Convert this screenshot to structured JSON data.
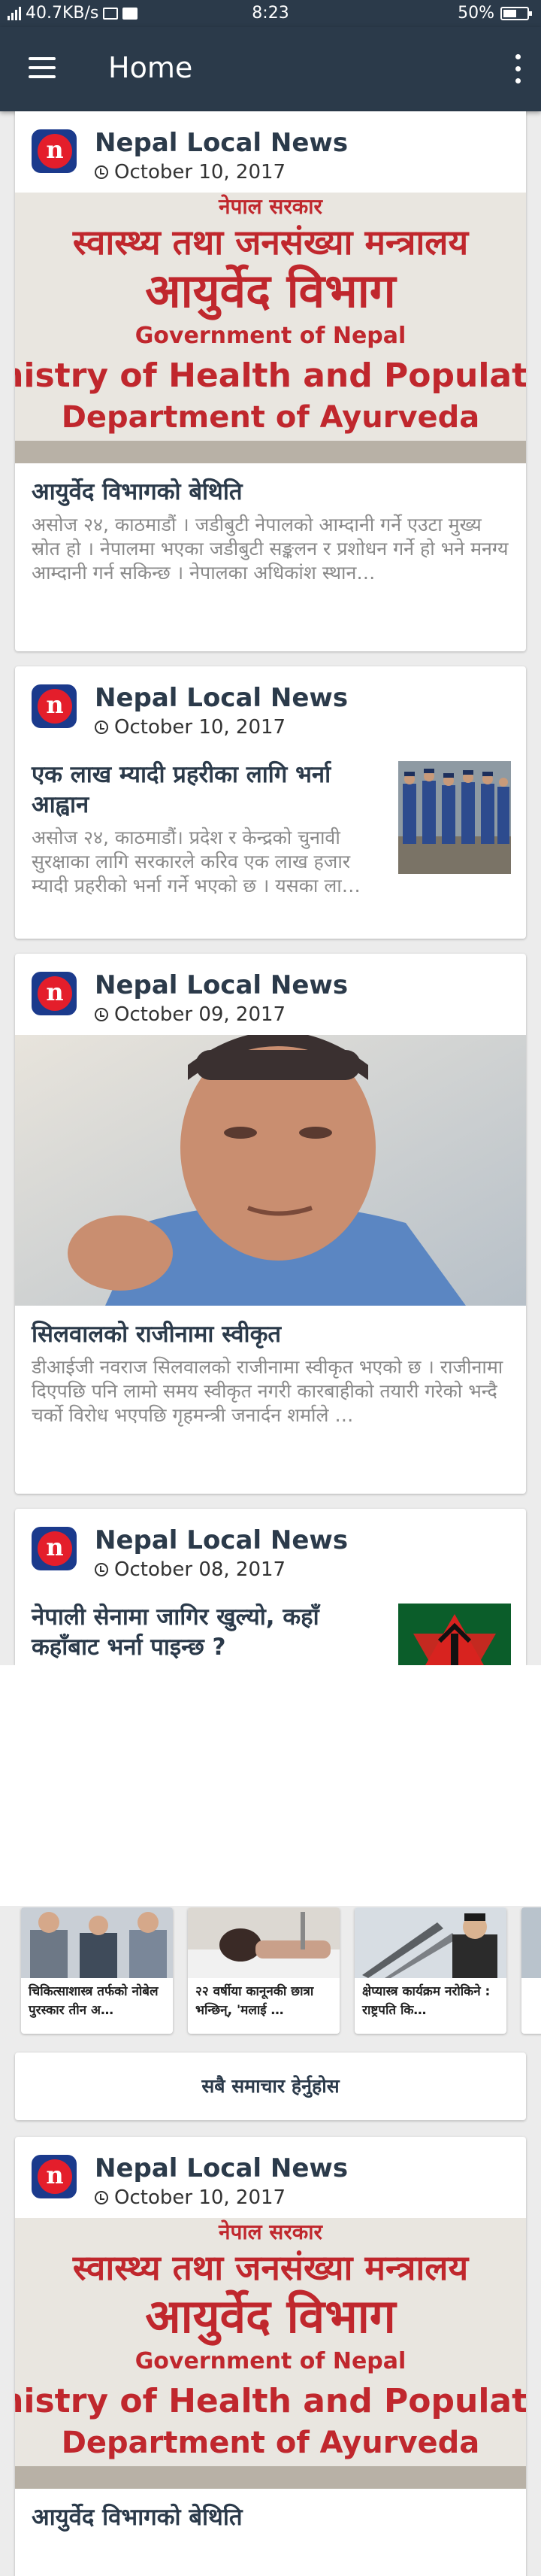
{
  "status_bar": {
    "speed": "40.7KB/s",
    "time": "8:23",
    "battery": "50%",
    "battery_level": 0.5
  },
  "app_bar": {
    "title": "Home",
    "menu_icon": "hamburger-menu-icon",
    "more_icon": "more-vertical-icon"
  },
  "articles": [
    {
      "source": "Nepal Local News",
      "date": "October 10, 2017",
      "headline": "आयुर्वेद विभागको बेथिति",
      "excerpt": "असोज २४, काठमाडौं ।  जडीबुटी नेपालको आम्दानी गर्ने एउटा मुख्य स्रोत हो । नेपालमा भएका जडीबुटी सङ्कलन र प्रशोधन गर्ने हो भने मनग्य आम्दानी गर्न सकिन्छ । नेपालका अधिकांश स्थान…",
      "image": "ministry-sign",
      "sign_lines": [
        "नेपाल सरकार",
        "स्वास्थ्य तथा जनसंख्या मन्त्रालय",
        "आयुर्वेद विभाग",
        "Government of Nepal",
        "Ministry of Health and Population",
        "Department of Ayurveda"
      ]
    },
    {
      "source": "Nepal Local News",
      "date": "October 10, 2017",
      "headline": "एक लाख म्यादी प्रहरीका लागि भर्ना आह्वान",
      "excerpt": "असोज २४, काठमाडौं।  प्रदेश र केन्द्रको चुनावी सुरक्षाका लागि सरकारले करिव एक लाख हजार म्यादी प्रहरीको भर्ना गर्ने भएको छ । यसका ला…",
      "image": "police-parade"
    },
    {
      "source": "Nepal Local News",
      "date": "October 09, 2017",
      "headline": "सिलवालको राजीनामा स्वीकृत",
      "excerpt": "डीआईजी नवराज सिलवालको राजीनामा स्वीकृत भएको छ । राजीनामा दिएपछि पनि लामो समय स्वीकृत नगरी कारबाहीको तयारी गरेको भन्दै चर्को विरोध भएपछि गृहमन्त्री जनार्दन शर्माले …",
      "image": "man-portrait"
    },
    {
      "source": "Nepal Local News",
      "date": "October 08, 2017",
      "headline": "नेपाली सेनामा जागिर खुल्यो, कहाँ कहाँबाट भर्ना पाइन्छ ?",
      "excerpt": "",
      "image": "army-emblem"
    },
    {
      "source": "Nepal Local News",
      "date": "October 10, 2017",
      "headline": "आयुर्वेद विभागको बेथिति",
      "excerpt": "",
      "image": "ministry-sign"
    }
  ],
  "carousel": [
    {
      "caption": "चिकित्साशास्त्र तर्फको नोबेल पुरस्कार तीन अ…",
      "image": "nobel-photo"
    },
    {
      "caption": "२२ वर्षीया कानूनकी छात्रा भन्छिन्, 'मलाई …",
      "image": "hospital-photo"
    },
    {
      "caption": "क्षेप्यास्त्र कार्यक्रम नरोकिने : राष्ट्रपति कि…",
      "image": "missile-photo"
    }
  ],
  "more_button": "सबै समाचार हेर्नुहोस"
}
